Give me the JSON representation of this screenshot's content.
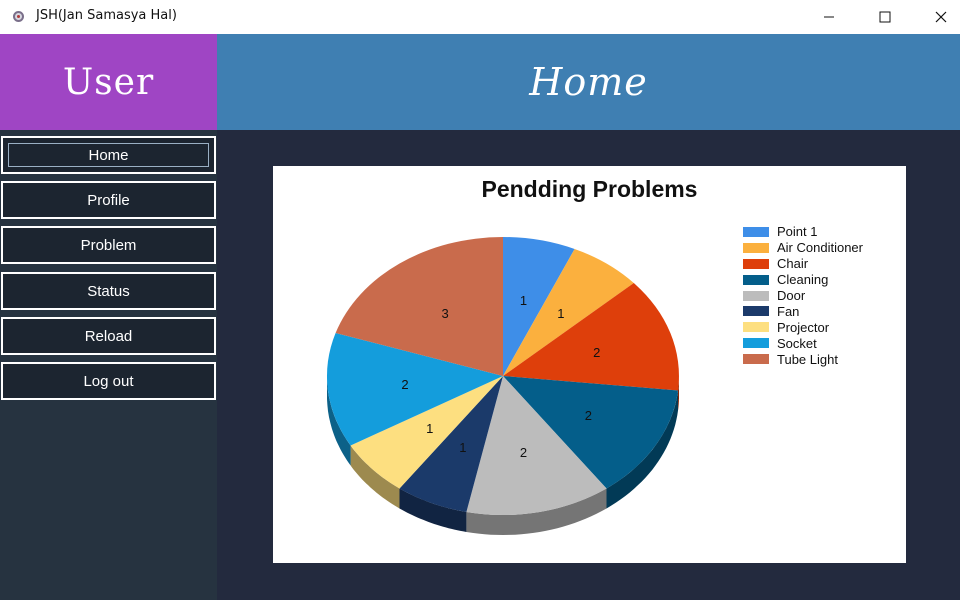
{
  "window": {
    "title": "JSH(Jan Samasya Hal)",
    "controls": [
      "minimize",
      "maximize",
      "close"
    ]
  },
  "header": {
    "user_label": "User",
    "page_title": "Home",
    "user_bg": "#9f45c4",
    "title_bg": "#3f7fb2"
  },
  "sidebar": {
    "items": [
      {
        "label": "Home",
        "active": true
      },
      {
        "label": "Profile"
      },
      {
        "label": "Problem"
      },
      {
        "label": "Status"
      },
      {
        "label": "Reload"
      },
      {
        "label": "Log out"
      }
    ]
  },
  "chart_data": {
    "type": "pie",
    "title": "Pendding Problems",
    "legend_position": "right",
    "slices": [
      {
        "name": "Point 1",
        "value": 1,
        "color": "#3e8ee8"
      },
      {
        "name": "Air Conditioner",
        "value": 1,
        "color": "#fbb03e"
      },
      {
        "name": "Chair",
        "value": 2,
        "color": "#de3f0b"
      },
      {
        "name": "Cleaning",
        "value": 2,
        "color": "#045e8a"
      },
      {
        "name": "Door",
        "value": 2,
        "color": "#bcbcbc"
      },
      {
        "name": "Fan",
        "value": 1,
        "color": "#1b3a6a"
      },
      {
        "name": "Projector",
        "value": 1,
        "color": "#fddf80"
      },
      {
        "name": "Socket",
        "value": 2,
        "color": "#149ddc"
      },
      {
        "name": "Tube Light",
        "value": 3,
        "color": "#c96b4c"
      }
    ]
  }
}
